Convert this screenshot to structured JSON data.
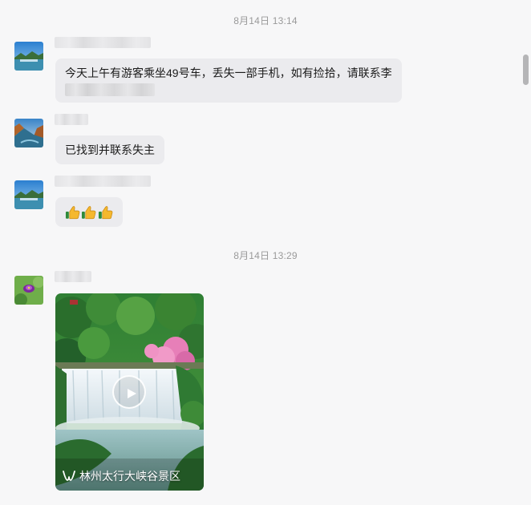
{
  "chat": {
    "messages_group1_time": "8月14日 13:14",
    "messages_group2_time": "8月14日 13:29",
    "messages": [
      {
        "id": "m1",
        "sender_name_hidden": true,
        "text_line1": "今天上午有游客乘坐49号车，丢失一部手机，如有捡拾，请联系李",
        "text_line2_hidden": true
      },
      {
        "id": "m2",
        "sender_name_hidden": true,
        "text": "已找到并联系失主"
      },
      {
        "id": "m3",
        "sender_name_hidden": true,
        "emoji": [
          "thumbs-up",
          "thumbs-up",
          "thumbs-up"
        ]
      },
      {
        "id": "m4",
        "sender_name_hidden": true,
        "video": {
          "caption": "林州太行大峡谷景区",
          "caption_icon": "channels-logo-icon"
        }
      }
    ]
  },
  "colors": {
    "background": "#f7f7f8",
    "bubble": "#ebebee",
    "timestamp": "#9a9a9a",
    "scrollbar": "#b5b5b7"
  }
}
